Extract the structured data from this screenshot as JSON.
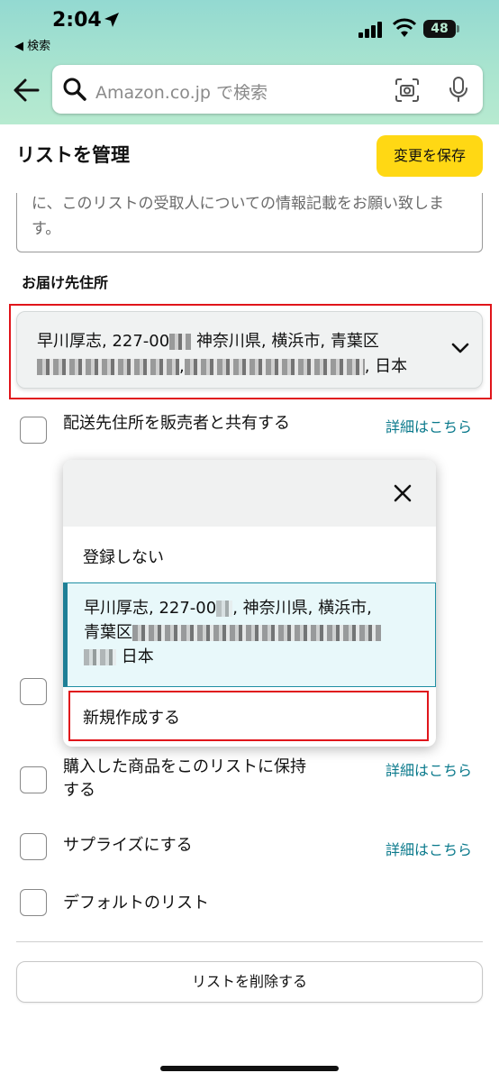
{
  "status_bar": {
    "time": "2:04",
    "back_app": "◀ 検索",
    "battery": "48"
  },
  "search": {
    "placeholder": "Amazon.co.jp で検索"
  },
  "header": {
    "title": "リストを管理",
    "save_label": "変更を保存"
  },
  "description": {
    "text": "に、このリストの受取人についての情報記載をお願い致します。"
  },
  "address": {
    "label": "お届け先住所",
    "selected_line1": "早川厚志, 227-00",
    "selected_line1_rest": "神奈川県, 横浜市, 青葉区",
    "selected_line2_end": ", 日本"
  },
  "options": [
    {
      "label": "配送先住所を販売者と共有する",
      "link": "詳細はこちら",
      "checked": false
    },
    {
      "label": "購入した商品をこのリストに保持する",
      "link": "詳細はこちら",
      "checked": false
    },
    {
      "label": "サプライズにする",
      "link": "詳細はこちら",
      "checked": false
    },
    {
      "label": "デフォルトのリスト",
      "link": "",
      "checked": false
    }
  ],
  "dropdown": {
    "none_label": "登録しない",
    "selected_line1": "早川厚志, 227-00",
    "selected_line1_rest": ", 神奈川県, 横浜市,",
    "selected_line2": "青葉区",
    "selected_line3_end": " 日本",
    "new_label": "新規作成する"
  },
  "delete_label": "リストを削除する",
  "colors": {
    "accent_link": "#0b7a8c",
    "save_button": "#ffd814",
    "highlight_red": "#e0151b"
  }
}
